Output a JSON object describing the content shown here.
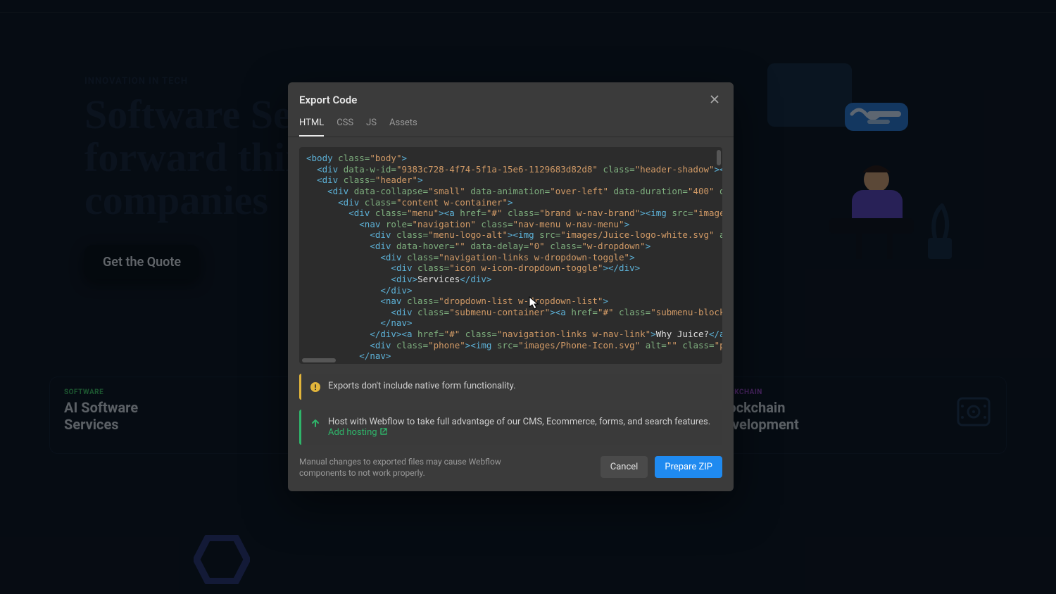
{
  "bg": {
    "eyebrow": "INNOVATION IN TECH",
    "title_line1": "Software Ser",
    "title_line2": "forward thin",
    "title_line3": "companies",
    "cta_label": "Get the Quote",
    "cards": [
      {
        "eyebrow": "SOFTWARE",
        "eyebrow_class": "green",
        "title": "AI Software Services"
      },
      {
        "eyebrow": "",
        "eyebrow_class": "green",
        "title": ""
      },
      {
        "eyebrow": "BLOCKCHAIN",
        "eyebrow_class": "purple",
        "title": "Blockchain Development"
      }
    ]
  },
  "modal": {
    "title": "Export Code",
    "tabs": [
      "HTML",
      "CSS",
      "JS",
      "Assets"
    ],
    "active_tab_index": 0,
    "code_lines": [
      [
        {
          "c": "t-tag",
          "t": "<body"
        },
        {
          "c": "t-attr",
          "t": " class="
        },
        {
          "c": "t-val",
          "t": "\"body\""
        },
        {
          "c": "t-tag",
          "t": ">"
        }
      ],
      [
        {
          "c": "t-punct",
          "t": "  "
        },
        {
          "c": "t-tag",
          "t": "<div"
        },
        {
          "c": "t-attr",
          "t": " data-w-id="
        },
        {
          "c": "t-val",
          "t": "\"9383c728-4f74-5f1a-15e6-1129683d82d8\""
        },
        {
          "c": "t-attr",
          "t": " class="
        },
        {
          "c": "t-val",
          "t": "\"header-shadow\""
        },
        {
          "c": "t-tag",
          "t": "></di"
        }
      ],
      [
        {
          "c": "t-punct",
          "t": "  "
        },
        {
          "c": "t-tag",
          "t": "<div"
        },
        {
          "c": "t-attr",
          "t": " class="
        },
        {
          "c": "t-val",
          "t": "\"header\""
        },
        {
          "c": "t-tag",
          "t": ">"
        }
      ],
      [
        {
          "c": "t-punct",
          "t": "    "
        },
        {
          "c": "t-tag",
          "t": "<div"
        },
        {
          "c": "t-attr",
          "t": " data-collapse="
        },
        {
          "c": "t-val",
          "t": "\"small\""
        },
        {
          "c": "t-attr",
          "t": " data-animation="
        },
        {
          "c": "t-val",
          "t": "\"over-left\""
        },
        {
          "c": "t-attr",
          "t": " data-duration="
        },
        {
          "c": "t-val",
          "t": "\"400\""
        },
        {
          "c": "t-attr",
          "t": " data"
        }
      ],
      [
        {
          "c": "t-punct",
          "t": "      "
        },
        {
          "c": "t-tag",
          "t": "<div"
        },
        {
          "c": "t-attr",
          "t": " class="
        },
        {
          "c": "t-val",
          "t": "\"content w-container\""
        },
        {
          "c": "t-tag",
          "t": ">"
        }
      ],
      [
        {
          "c": "t-punct",
          "t": "        "
        },
        {
          "c": "t-tag",
          "t": "<div"
        },
        {
          "c": "t-attr",
          "t": " class="
        },
        {
          "c": "t-val",
          "t": "\"menu\""
        },
        {
          "c": "t-tag",
          "t": "><a"
        },
        {
          "c": "t-attr",
          "t": " href="
        },
        {
          "c": "t-val",
          "t": "\"#\""
        },
        {
          "c": "t-attr",
          "t": " class="
        },
        {
          "c": "t-val",
          "t": "\"brand w-nav-brand\""
        },
        {
          "c": "t-tag",
          "t": "><img"
        },
        {
          "c": "t-attr",
          "t": " src="
        },
        {
          "c": "t-val",
          "t": "\"images/J"
        }
      ],
      [
        {
          "c": "t-punct",
          "t": "          "
        },
        {
          "c": "t-tag",
          "t": "<nav"
        },
        {
          "c": "t-attr",
          "t": " role="
        },
        {
          "c": "t-val",
          "t": "\"navigation\""
        },
        {
          "c": "t-attr",
          "t": " class="
        },
        {
          "c": "t-val",
          "t": "\"nav-menu w-nav-menu\""
        },
        {
          "c": "t-tag",
          "t": ">"
        }
      ],
      [
        {
          "c": "t-punct",
          "t": "            "
        },
        {
          "c": "t-tag",
          "t": "<div"
        },
        {
          "c": "t-attr",
          "t": " class="
        },
        {
          "c": "t-val",
          "t": "\"menu-logo-alt\""
        },
        {
          "c": "t-tag",
          "t": "><img"
        },
        {
          "c": "t-attr",
          "t": " src="
        },
        {
          "c": "t-val",
          "t": "\"images/Juice-logo-white.svg\""
        },
        {
          "c": "t-attr",
          "t": " alt="
        }
      ],
      [
        {
          "c": "t-punct",
          "t": "            "
        },
        {
          "c": "t-tag",
          "t": "<div"
        },
        {
          "c": "t-attr",
          "t": " data-hover="
        },
        {
          "c": "t-val",
          "t": "\"\""
        },
        {
          "c": "t-attr",
          "t": " data-delay="
        },
        {
          "c": "t-val",
          "t": "\"0\""
        },
        {
          "c": "t-attr",
          "t": " class="
        },
        {
          "c": "t-val",
          "t": "\"w-dropdown\""
        },
        {
          "c": "t-tag",
          "t": ">"
        }
      ],
      [
        {
          "c": "t-punct",
          "t": "              "
        },
        {
          "c": "t-tag",
          "t": "<div"
        },
        {
          "c": "t-attr",
          "t": " class="
        },
        {
          "c": "t-val",
          "t": "\"navigation-links w-dropdown-toggle\""
        },
        {
          "c": "t-tag",
          "t": ">"
        }
      ],
      [
        {
          "c": "t-punct",
          "t": "                "
        },
        {
          "c": "t-tag",
          "t": "<div"
        },
        {
          "c": "t-attr",
          "t": " class="
        },
        {
          "c": "t-val",
          "t": "\"icon w-icon-dropdown-toggle\""
        },
        {
          "c": "t-tag",
          "t": "></div>"
        }
      ],
      [
        {
          "c": "t-punct",
          "t": "                "
        },
        {
          "c": "t-tag",
          "t": "<div>"
        },
        {
          "c": "t-text",
          "t": "Services"
        },
        {
          "c": "t-tag",
          "t": "</div>"
        }
      ],
      [
        {
          "c": "t-punct",
          "t": "              "
        },
        {
          "c": "t-tag",
          "t": "</div>"
        }
      ],
      [
        {
          "c": "t-punct",
          "t": "              "
        },
        {
          "c": "t-tag",
          "t": "<nav"
        },
        {
          "c": "t-attr",
          "t": " class="
        },
        {
          "c": "t-val",
          "t": "\"dropdown-list w-dropdown-list\""
        },
        {
          "c": "t-tag",
          "t": ">"
        }
      ],
      [
        {
          "c": "t-punct",
          "t": "                "
        },
        {
          "c": "t-tag",
          "t": "<div"
        },
        {
          "c": "t-attr",
          "t": " class="
        },
        {
          "c": "t-val",
          "t": "\"submenu-container\""
        },
        {
          "c": "t-tag",
          "t": "><a"
        },
        {
          "c": "t-attr",
          "t": " href="
        },
        {
          "c": "t-val",
          "t": "\"#\""
        },
        {
          "c": "t-attr",
          "t": " class="
        },
        {
          "c": "t-val",
          "t": "\"submenu-block w-"
        }
      ],
      [
        {
          "c": "t-punct",
          "t": "              "
        },
        {
          "c": "t-tag",
          "t": "</nav>"
        }
      ],
      [
        {
          "c": "t-punct",
          "t": "            "
        },
        {
          "c": "t-tag",
          "t": "</div><a"
        },
        {
          "c": "t-attr",
          "t": " href="
        },
        {
          "c": "t-val",
          "t": "\"#\""
        },
        {
          "c": "t-attr",
          "t": " class="
        },
        {
          "c": "t-val",
          "t": "\"navigation-links w-nav-link\""
        },
        {
          "c": "t-tag",
          "t": ">"
        },
        {
          "c": "t-text",
          "t": "Why Juice?"
        },
        {
          "c": "t-tag",
          "t": "</a><a"
        }
      ],
      [
        {
          "c": "t-punct",
          "t": "            "
        },
        {
          "c": "t-tag",
          "t": "<div"
        },
        {
          "c": "t-attr",
          "t": " class="
        },
        {
          "c": "t-val",
          "t": "\"phone\""
        },
        {
          "c": "t-tag",
          "t": "><img"
        },
        {
          "c": "t-attr",
          "t": " src="
        },
        {
          "c": "t-val",
          "t": "\"images/Phone-Icon.svg\""
        },
        {
          "c": "t-attr",
          "t": " alt="
        },
        {
          "c": "t-val",
          "t": "\"\""
        },
        {
          "c": "t-attr",
          "t": " class="
        },
        {
          "c": "t-val",
          "t": "\"phon"
        }
      ],
      [
        {
          "c": "t-punct",
          "t": "          "
        },
        {
          "c": "t-tag",
          "t": "</nav>"
        }
      ]
    ],
    "notice_warning": "Exports don't include native form functionality.",
    "notice_info": "Host with Webflow to take full advantage of our CMS, Ecommerce, forms, and search features.",
    "notice_info_link": "Add hosting",
    "footer_note": "Manual changes to exported files may cause Webflow components to not work properly.",
    "cancel_label": "Cancel",
    "primary_label": "Prepare ZIP"
  }
}
